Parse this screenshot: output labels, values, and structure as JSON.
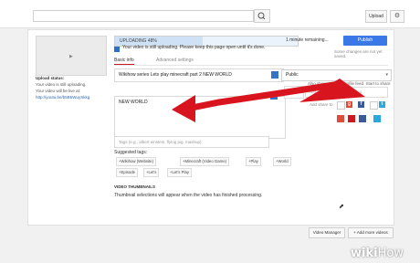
{
  "topbar": {
    "upload_label": "Upload",
    "gear_label": "⚙"
  },
  "thumbnail": {
    "icon": "play-icon"
  },
  "upload_status": {
    "title": "Upload status:",
    "line1": "Your video is still uploading.",
    "line2": "Your video will be live at:",
    "link": "http://youtu.be/b5B5WuySkkg"
  },
  "progress": {
    "label": "UPLOADING 48%",
    "percent": 48,
    "remaining": "1 minute remaining...",
    "publish_label": "Publish",
    "saved_note": "Some changes are not yet saved."
  },
  "info": {
    "message": "Your video is still uploading. Please keep this page open until it's done."
  },
  "tabs": {
    "basic": "Basic info",
    "advanced": "Advanced settings"
  },
  "form": {
    "title_value": "Wikihow series Lets play minecraft part 2 NEW WORLD",
    "description_value": "NEW WORLD",
    "tags_placeholder": "Tags (e.g., albert einstein, flying pig, mashup)"
  },
  "suggested": {
    "label": "Suggested tags:",
    "tags": [
      "+Wikihow (Website)",
      "+Minecraft (Video Game)",
      "+Play",
      "+World",
      "+Episode",
      "+Let's",
      "+Let's Play"
    ]
  },
  "video_thumbnails": {
    "label": "VIDEO THUMBNAILS",
    "text": "Thumbnail selections will appear when the video has finished processing."
  },
  "privacy": {
    "value": "Public",
    "share_note": "Also share on your profile feed. Start to share it!",
    "message_placeholder": "Add a message to your video",
    "add_note": "Add share to"
  },
  "footer": {
    "video_manager": "Video Manager",
    "add_more": "+ Add more videos"
  },
  "watermark": {
    "wiki": "wiki",
    "how": "How"
  },
  "colors": {
    "accent_blue": "#3b78e7",
    "arrow_red": "#d8141e"
  }
}
